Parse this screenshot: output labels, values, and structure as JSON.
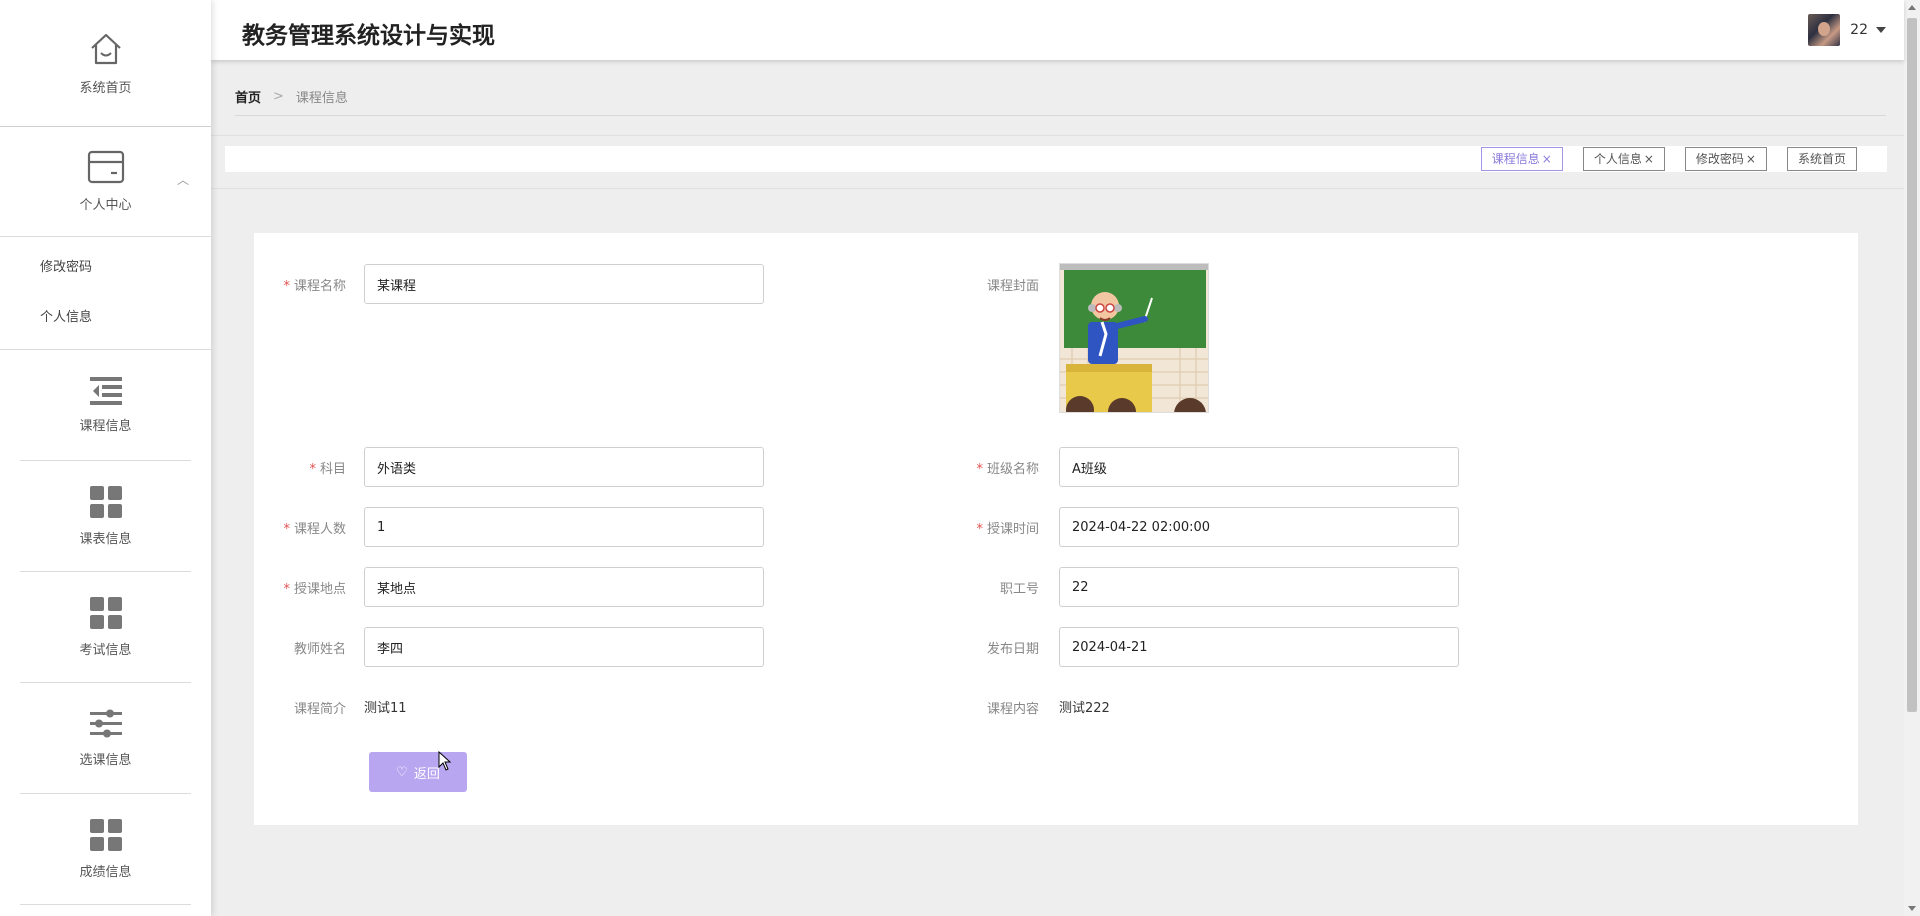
{
  "app": {
    "title": "教务管理系统设计与实现"
  },
  "user": {
    "name": "22"
  },
  "sidebar": {
    "home": {
      "label": "系统首页",
      "icon": "home-icon"
    },
    "personal": {
      "label": "个人中心",
      "icon": "card-icon",
      "expanded": true,
      "children": [
        {
          "label": "修改密码"
        },
        {
          "label": "个人信息"
        }
      ]
    },
    "items": [
      {
        "label": "课程信息",
        "icon": "menu-list-icon"
      },
      {
        "label": "课表信息",
        "icon": "grid-icon"
      },
      {
        "label": "考试信息",
        "icon": "grid-icon"
      },
      {
        "label": "选课信息",
        "icon": "sliders-icon"
      },
      {
        "label": "成绩信息",
        "icon": "grid-icon"
      }
    ]
  },
  "breadcrumb": {
    "home": "首页",
    "separator": ">",
    "current": "课程信息"
  },
  "tags": [
    {
      "label": "课程信息",
      "active": true,
      "closable": true
    },
    {
      "label": "个人信息",
      "active": false,
      "closable": true
    },
    {
      "label": "修改密码",
      "active": false,
      "closable": true
    },
    {
      "label": "系统首页",
      "active": false,
      "closable": false
    }
  ],
  "form": {
    "course_name": {
      "label": "课程名称",
      "required": true,
      "value": "某课程"
    },
    "cover": {
      "label": "课程封面",
      "image": "teacher-at-blackboard-illustration"
    },
    "subject": {
      "label": "科目",
      "required": true,
      "value": "外语类"
    },
    "class_name": {
      "label": "班级名称",
      "required": true,
      "value": "A班级"
    },
    "student_count": {
      "label": "课程人数",
      "required": true,
      "value": "1"
    },
    "class_time": {
      "label": "授课时间",
      "required": true,
      "value": "2024-04-22 02:00:00"
    },
    "location": {
      "label": "授课地点",
      "required": true,
      "value": "某地点"
    },
    "staff_id": {
      "label": "职工号",
      "required": false,
      "value": "22"
    },
    "teacher_name": {
      "label": "教师姓名",
      "required": false,
      "value": "李四"
    },
    "publish_date": {
      "label": "发布日期",
      "required": false,
      "value": "2024-04-21"
    },
    "intro": {
      "label": "课程简介",
      "value": "测试11"
    },
    "content": {
      "label": "课程内容",
      "value": "测试222"
    },
    "back_button": {
      "label": "返回",
      "icon": "heart-icon"
    }
  },
  "colors": {
    "accent": "#b8a6f0",
    "accent_text": "#8c7bdc",
    "required": "#e05050"
  },
  "tag_close_glyph": "×",
  "req_mark": "*"
}
